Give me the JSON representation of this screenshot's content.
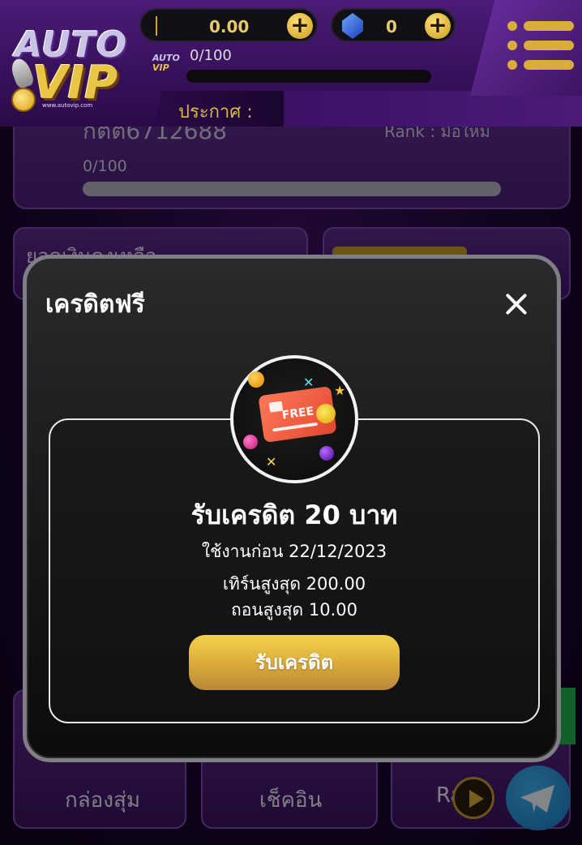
{
  "header": {
    "logo_text": "AUTO VIP",
    "logo_url": "www.autovip.com",
    "balance": "0.00",
    "gems": "0",
    "level_progress": "0/100",
    "level_fraction": 0,
    "announcement_label": "ประกาศ :",
    "mini_logo_line1": "AUTO",
    "mini_logo_line2": "VIP"
  },
  "profile": {
    "username": "กิตติ6712688",
    "rank": "Rank : มือใหม่",
    "progress": "0/100",
    "progress_fraction": 0
  },
  "background": {
    "card_text": "ยอดเงินคงเหลือ",
    "tiles": [
      "กล่องสุ่ม",
      "เช็คอิน",
      "Rank"
    ]
  },
  "modal": {
    "title": "เครดิตฟรี",
    "badge_card_text": "FREE",
    "reward_title": "รับเครดิต 20 บาท",
    "expiry": "ใช้งานก่อน 22/12/2023",
    "max_turnover": "เทิร์นสูงสุด 200.00",
    "max_withdraw": "ถอนสูงสุด 10.00",
    "claim_button": "รับเครดิต"
  }
}
